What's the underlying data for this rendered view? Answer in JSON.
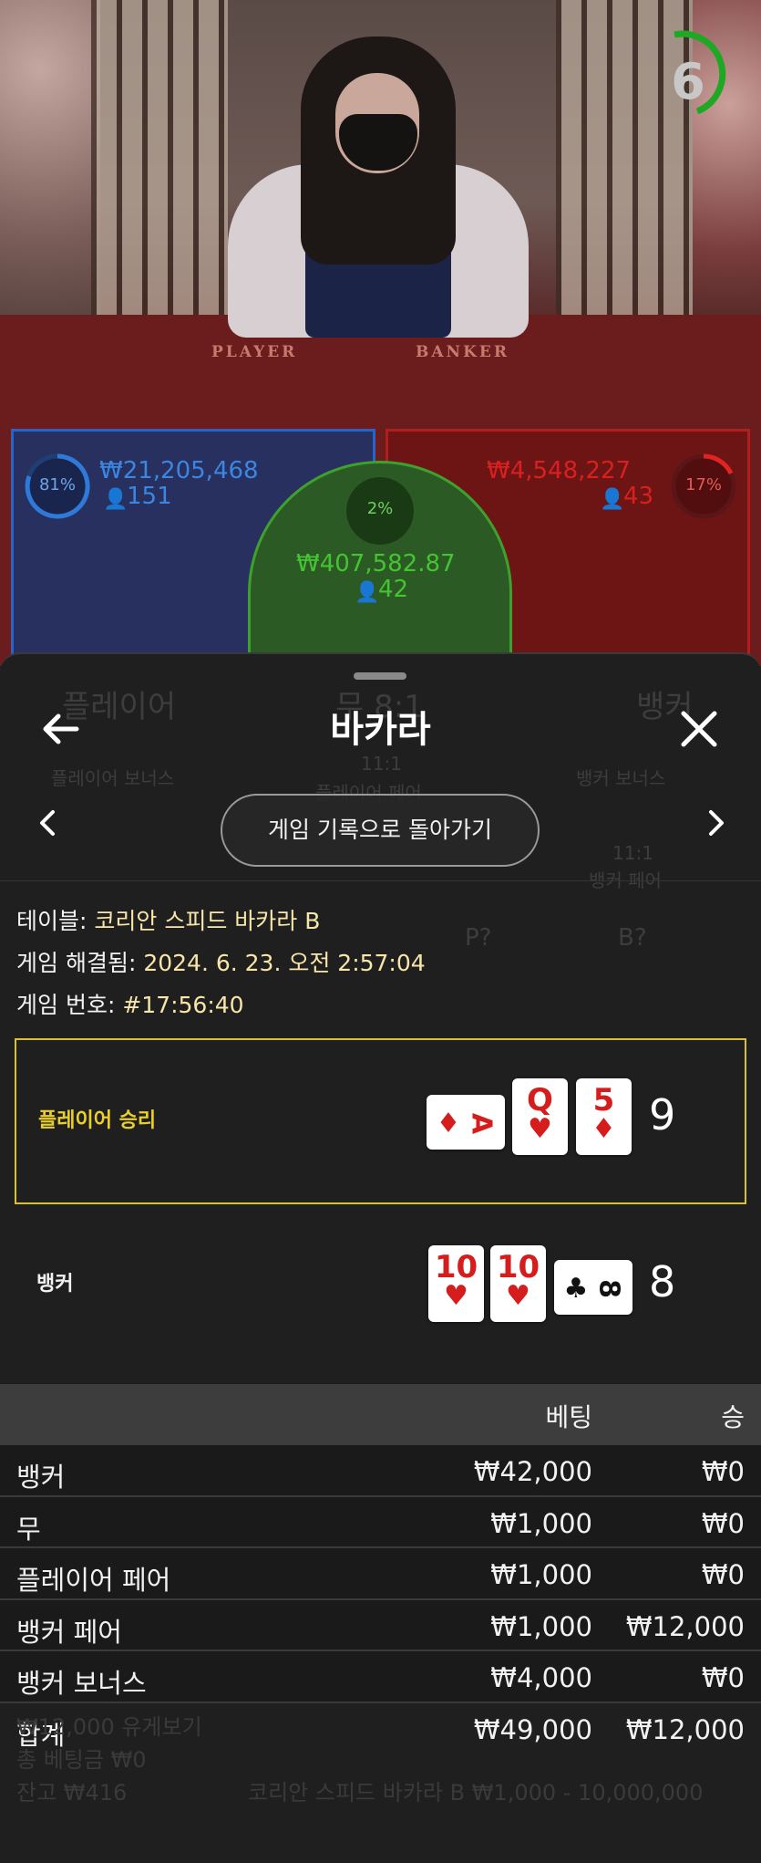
{
  "timer": {
    "seconds": "6"
  },
  "felt": {
    "player_text": "PLAYER",
    "banker_text": "BANKER"
  },
  "bets": {
    "player": {
      "percent": "81%",
      "amount": "₩21,205,468",
      "players": "151",
      "color": "#2a63c6"
    },
    "tie": {
      "percent": "2%",
      "amount": "₩407,582.87",
      "players": "42",
      "color": "#3ea02d"
    },
    "banker": {
      "percent": "17%",
      "amount": "₩4,548,227",
      "players": "43",
      "color": "#d12020"
    }
  },
  "sheet": {
    "title": "바카라",
    "return_button": "게임 기록으로 돌아가기",
    "info": {
      "table_label": "테이블: ",
      "table_value": "코리안 스피드 바카라 B",
      "resolved_label": "게임 해결됨: ",
      "resolved_value": "2024. 6. 23. 오전 2:57:04",
      "number_label": "게임 번호: ",
      "number_value": "#17:56:40"
    },
    "hands": {
      "player": {
        "label": "플레이어 승리",
        "total": "9",
        "cards": [
          {
            "rank": "A",
            "suit": "♦",
            "color": "red",
            "sideways": true
          },
          {
            "rank": "Q",
            "suit": "♥",
            "color": "red",
            "sideways": false
          },
          {
            "rank": "5",
            "suit": "♦",
            "color": "red",
            "sideways": false
          }
        ]
      },
      "banker": {
        "label": "뱅커",
        "total": "8",
        "cards": [
          {
            "rank": "10",
            "suit": "♥",
            "color": "red",
            "sideways": false
          },
          {
            "rank": "10",
            "suit": "♥",
            "color": "red",
            "sideways": false
          },
          {
            "rank": "8",
            "suit": "♣",
            "color": "black",
            "sideways": true
          }
        ]
      }
    },
    "bet_table": {
      "headers": {
        "bet": "베팅",
        "win": "승"
      },
      "rows": [
        {
          "name": "뱅커",
          "bet": "₩42,000",
          "win": "₩0"
        },
        {
          "name": "무",
          "bet": "₩1,000",
          "win": "₩0"
        },
        {
          "name": "플레이어 페어",
          "bet": "₩1,000",
          "win": "₩0"
        },
        {
          "name": "뱅커 페어",
          "bet": "₩1,000",
          "win": "₩12,000"
        },
        {
          "name": "뱅커 보너스",
          "bet": "₩4,000",
          "win": "₩0"
        }
      ],
      "total": {
        "name": "합계",
        "bet": "₩49,000",
        "win": "₩12,000"
      }
    }
  },
  "background_ghost": {
    "player": "플레이어",
    "tie": "무 8:1",
    "banker": "뱅커",
    "player_bonus": "플레이어 보너스",
    "player_pair_odds": "11:1",
    "player_pair": "플레이어 페어",
    "banker_bonus": "뱅커 보너스",
    "banker_pair_odds": "11:1",
    "banker_pair": "뱅커 페어",
    "p_ask": "P?",
    "b_ask": "B?",
    "win_line": "₩12,000 유게보기",
    "total_bet": "총 베팅금 ₩0",
    "balance": "잔고 ₩416",
    "table_limits": "코리안 스피드 바카라 B ₩1,000 - 10,000,000"
  }
}
